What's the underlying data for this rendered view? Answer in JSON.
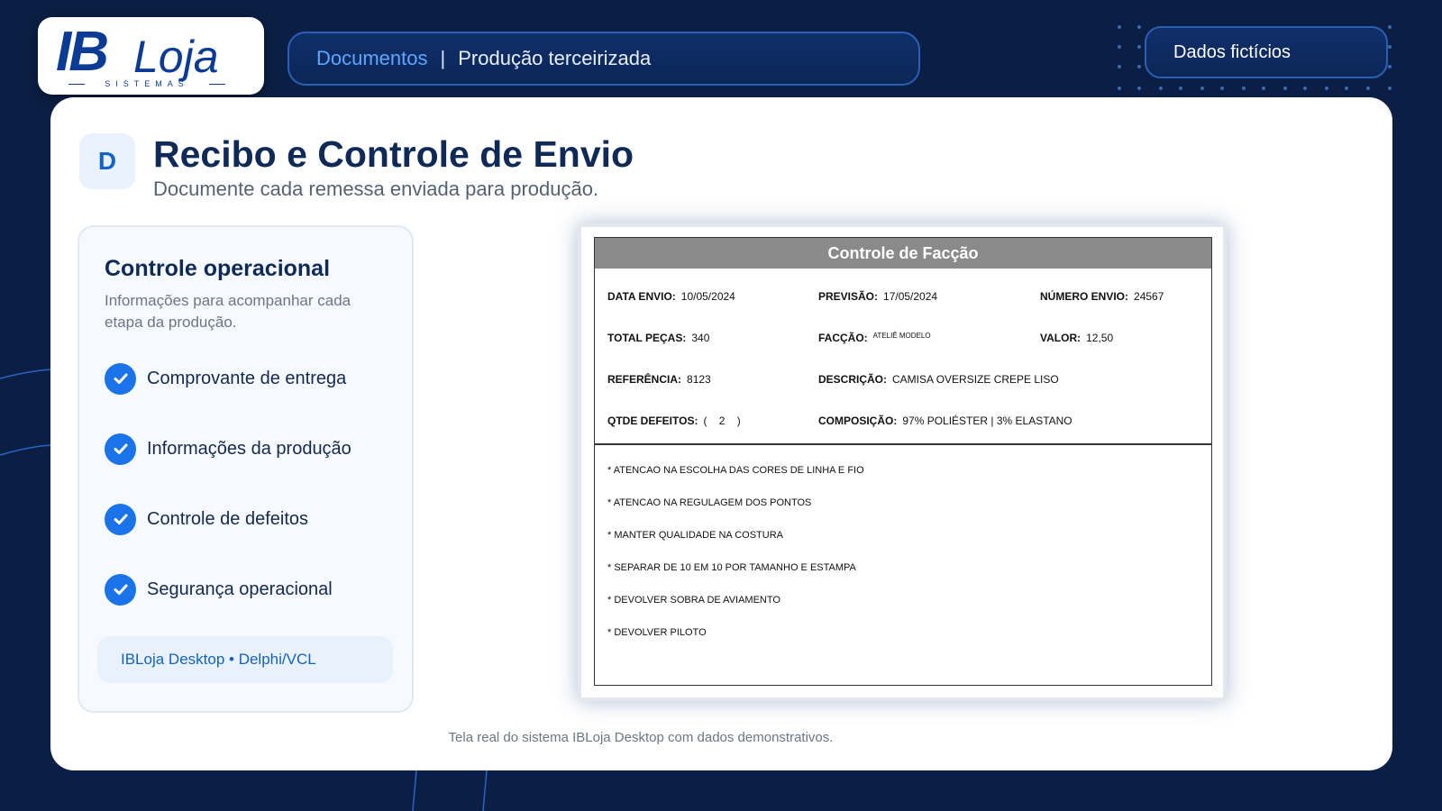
{
  "brand": {
    "logo_main": "IB",
    "logo_word": "Loja",
    "logo_tagline": "SISTEMAS",
    "accent": "#1a73e8",
    "navy": "#0b1f44"
  },
  "breadcrumb": {
    "section": "Documentos",
    "separator": "|",
    "current": "Produção terceirizada"
  },
  "badge": {
    "label": "Dados fictícios"
  },
  "header": {
    "letter": "D",
    "title": "Recibo e Controle de Envio",
    "subtitle": "Documente cada remessa enviada para produção."
  },
  "panel": {
    "title": "Controle operacional",
    "description": "Informações para acompanhar cada etapa da produção.",
    "features": [
      {
        "label": "Comprovante de entrega",
        "icon": "check-circle-icon"
      },
      {
        "label": "Informações da produção",
        "icon": "check-circle-icon"
      },
      {
        "label": "Controle de defeitos",
        "icon": "check-circle-icon"
      },
      {
        "label": "Segurança operacional",
        "icon": "check-circle-icon"
      }
    ],
    "tech": "IBLoja Desktop • Delphi/VCL"
  },
  "document": {
    "title": "Controle de Facção",
    "fields": {
      "data_envio": {
        "label": "DATA ENVIO:",
        "value": "10/05/2024"
      },
      "previsao": {
        "label": "PREVISÃO:",
        "value": "17/05/2024"
      },
      "numero_envio": {
        "label": "NÚMERO ENVIO:",
        "value": "24567"
      },
      "total_pecas": {
        "label": "TOTAL PEÇAS:",
        "value": "340"
      },
      "faccao": {
        "label": "FACÇÃO:",
        "value": "ATELIÊ MODELO"
      },
      "valor": {
        "label": "VALOR:",
        "value": "12,50"
      },
      "referencia": {
        "label": "REFERÊNCIA:",
        "value": "8123"
      },
      "descricao": {
        "label": "DESCRIÇÃO:",
        "value": "CAMISA OVERSIZE CREPE LISO"
      },
      "qtde_defeitos": {
        "label": "QTDE DEFEITOS:",
        "value": "(    2    )"
      },
      "composicao": {
        "label": "COMPOSIÇÃO:",
        "value": "97% POLIÉSTER | 3% ELASTANO"
      }
    },
    "notes": [
      "* ATENCAO NA ESCOLHA DAS CORES DE LINHA E FIO",
      "* ATENCAO NA REGULAGEM DOS PONTOS",
      "* MANTER QUALIDADE NA COSTURA",
      "* SEPARAR DE 10 EM 10 POR TAMANHO E ESTAMPA",
      "* DEVOLVER SOBRA DE AVIAMENTO",
      "* DEVOLVER PILOTO"
    ]
  },
  "footer": {
    "note": "Tela real do sistema IBLoja Desktop com dados demonstrativos."
  }
}
